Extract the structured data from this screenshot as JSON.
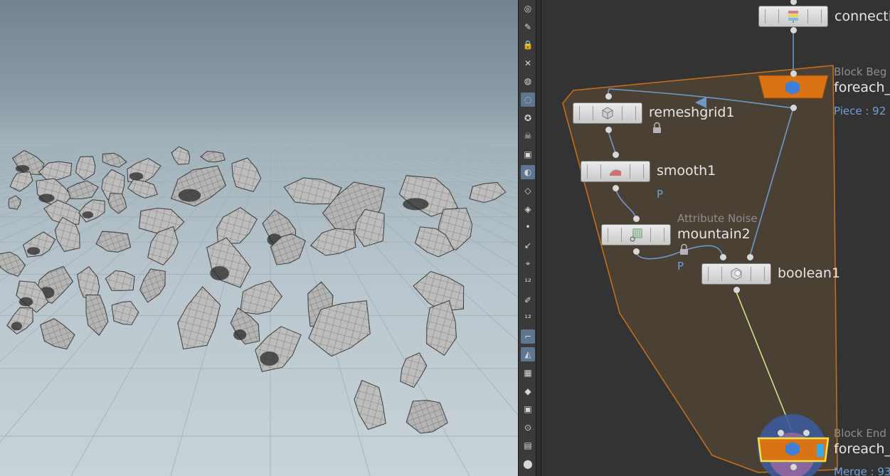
{
  "network": {
    "connectivity": {
      "label": "connecti"
    },
    "foreach_begin": {
      "type": "Block Beg",
      "label": "foreach_",
      "info": "Piece : 92"
    },
    "remeshgrid1": {
      "label": "remeshgrid1"
    },
    "smooth1": {
      "label": "smooth1",
      "flag": "P"
    },
    "mountain2": {
      "type": "Attribute Noise",
      "label": "mountain2",
      "flag": "P"
    },
    "boolean1": {
      "label": "boolean1"
    },
    "foreach_end": {
      "type": "Block End",
      "label": "foreach_",
      "info": "Merge : 93"
    }
  },
  "toolbar": {
    "icons": [
      "display-options-icon",
      "reference-plane-icon",
      "lock-camera-icon",
      "wireframe-ghost-icon",
      "shading-icon",
      "light-bulb-icon",
      "headlight-icon",
      "skull-icon",
      "display-points-icon",
      "visibility-toggle-icon",
      "template-icon",
      "point-display-icon",
      "normals-icon",
      "pin-icon",
      "point-numbers-icon",
      "brush-icon",
      "primitive-numbers-icon",
      "uv-border-icon",
      "snap-icon",
      "grid-snap-icon",
      "prim-snap-icon",
      "multi-snap-icon",
      "hud-icon",
      "circle-icon",
      "image-icon",
      "location-pin-icon"
    ]
  },
  "colors": {
    "accent": "#e07812",
    "selection": "#6fa0d8",
    "wire": "#6f97c9",
    "wire_highlight": "#d4e08a",
    "network_bg": "#333333"
  }
}
